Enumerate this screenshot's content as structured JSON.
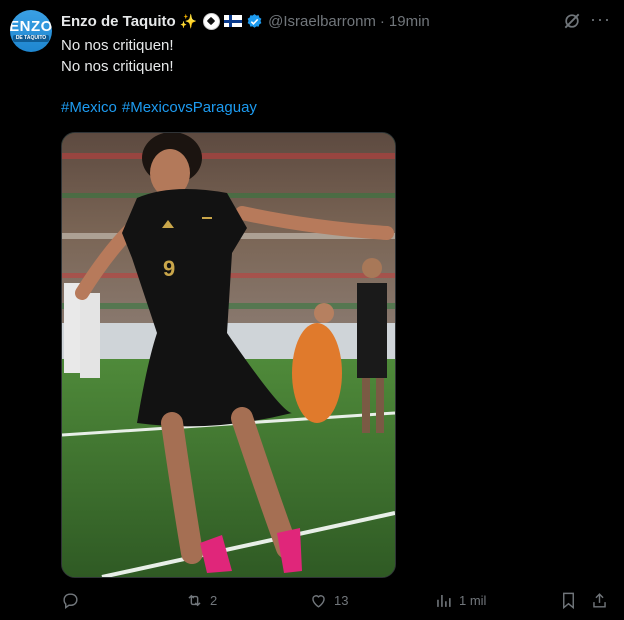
{
  "author": {
    "avatar_text_big": "ENZO",
    "avatar_text_small": "DE TAQUITO",
    "display_name": "Enzo de Taquito",
    "handle": "@Israelbarronm",
    "separator": "·",
    "time": "19min",
    "emojis": [
      "sparkles",
      "soccer-ball",
      "finland-flag"
    ]
  },
  "tweet": {
    "lines": [
      "No nos critiquen!",
      "No nos critiquen!"
    ],
    "hashtags": [
      "#Mexico",
      "#MexicovsParaguay"
    ]
  },
  "actions": {
    "reply": {
      "icon": "reply-icon",
      "count": ""
    },
    "retweet": {
      "icon": "retweet-icon",
      "count": "2"
    },
    "like": {
      "icon": "heart-icon",
      "count": "13"
    },
    "views": {
      "icon": "views-icon",
      "count": "1 mil"
    },
    "bookmark": {
      "icon": "bookmark-icon"
    },
    "share": {
      "icon": "share-icon"
    }
  },
  "colors": {
    "background": "#000000",
    "text": "#e7e9ea",
    "muted": "#71767b",
    "link": "#1d9bf0",
    "pitch": "#3e6d2f"
  }
}
